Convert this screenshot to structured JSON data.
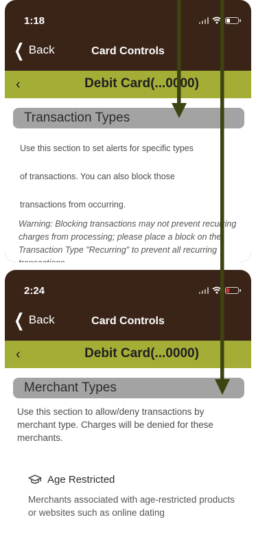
{
  "screen1": {
    "status_time": "1:18",
    "back_label": "Back",
    "nav_title": "Card Controls",
    "card_label": "Debit Card(...0000)",
    "section_title": "Transaction Types",
    "desc_line1": "Use this section to set alerts for specific types",
    "desc_line2": "of transactions. You can also block those",
    "desc_line3": "transactions from occurring.",
    "warning": "Warning: Blocking transactions may not prevent recurring charges from processing; please place a block on the Transaction Type \"Recurring\" to prevent all recurring transactions"
  },
  "screen2": {
    "status_time": "2:24",
    "back_label": "Back",
    "nav_title": "Card Controls",
    "card_label": "Debit Card(...0000)",
    "section_title": "Merchant Types",
    "description": "Use this section to allow/deny transactions by merchant type. Charges will be denied for these merchants.",
    "item_title": "Age Restricted",
    "item_icon": "graduation-cap-icon",
    "item_description": "Merchants associated with age-restricted products or websites such as online dating"
  },
  "colors": {
    "header_brown": "#3a2418",
    "card_bar_olive": "#a4ad36",
    "section_gray": "#a3a3a3",
    "arrow_dark_green": "#3e4312",
    "battery_low_red": "#e0322d"
  }
}
